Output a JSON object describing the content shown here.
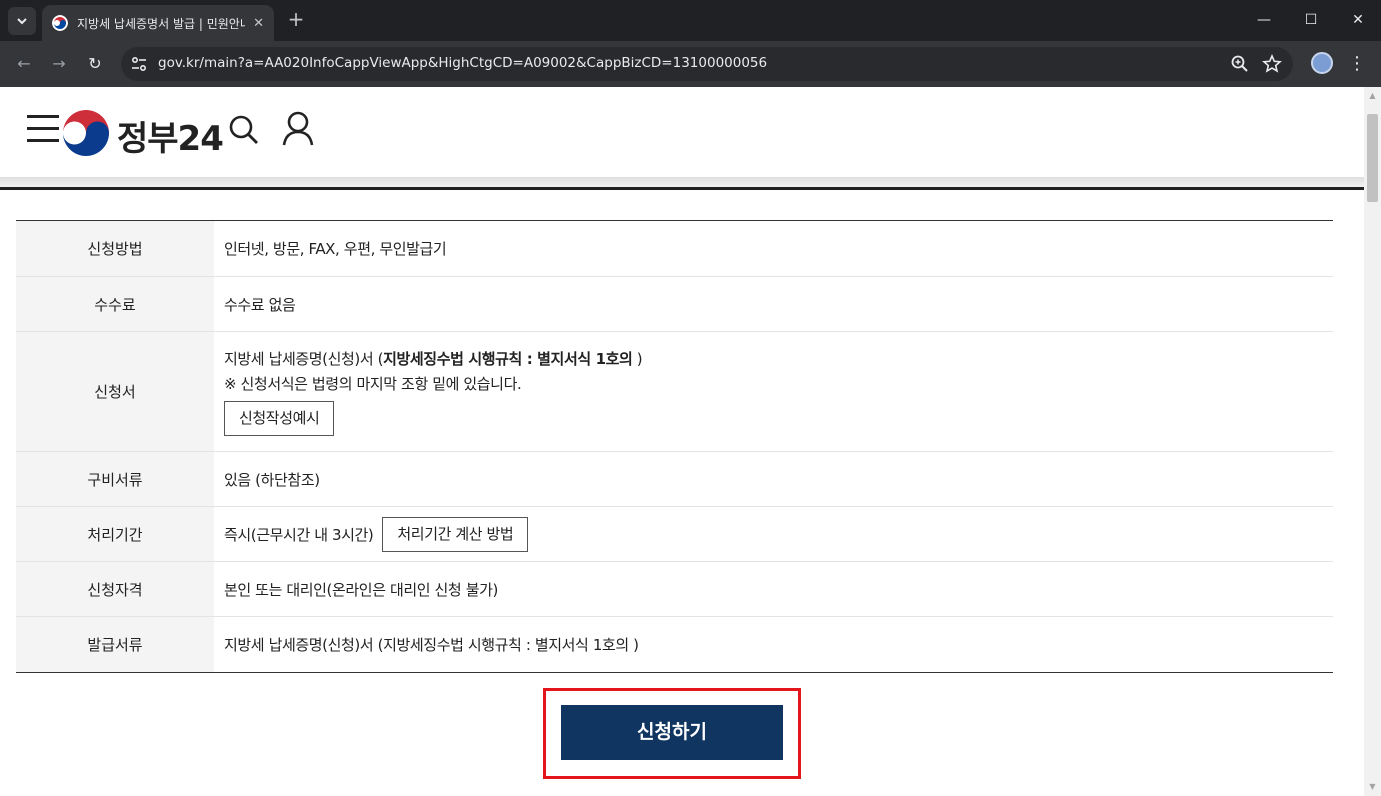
{
  "browser": {
    "tab_title": "지방세 납세증명서 발급 | 민원안내",
    "tab_close": "✕",
    "new_tab": "+",
    "url": "gov.kr/main?a=AA020InfoCappViewApp&HighCtgCD=A09002&CappBizCD=13100000056",
    "window_controls": {
      "minimize": "—",
      "maximize": "☐",
      "close": "✕"
    },
    "nav": {
      "back": "←",
      "forward": "→",
      "reload": "↻"
    },
    "menu": "⋮"
  },
  "header": {
    "logo_text": "정부24"
  },
  "info_rows": [
    {
      "label": "신청방법",
      "value": "인터넷, 방문, FAX, 우편, 무인발급기"
    },
    {
      "label": "수수료",
      "value": "수수료 없음"
    },
    {
      "label": "신청서",
      "line1_prefix": "지방세 납세증명(신청)서 (",
      "line1_bold": "지방세징수법 시행규칙 : 별지서식 1호의",
      "line1_suffix": " )",
      "line2": "※ 신청서식은 법령의 마지막 조항 밑에 있습니다.",
      "button": "신청작성예시"
    },
    {
      "label": "구비서류",
      "value": "있음 (하단참조)"
    },
    {
      "label": "처리기간",
      "value": "즉시(근무시간 내 3시간)",
      "button": "처리기간 계산 방법"
    },
    {
      "label": "신청자격",
      "value": "본인 또는 대리인(온라인은 대리인 신청 불가)"
    },
    {
      "label": "발급서류",
      "value": "지방세 납세증명(신청)서 (지방세징수법 시행규칙 : 별지서식 1호의 )"
    }
  ],
  "apply_button": "신청하기",
  "colors": {
    "apply_bg": "#103560",
    "highlight_border": "#e2161b",
    "chrome_dark": "#202124"
  }
}
